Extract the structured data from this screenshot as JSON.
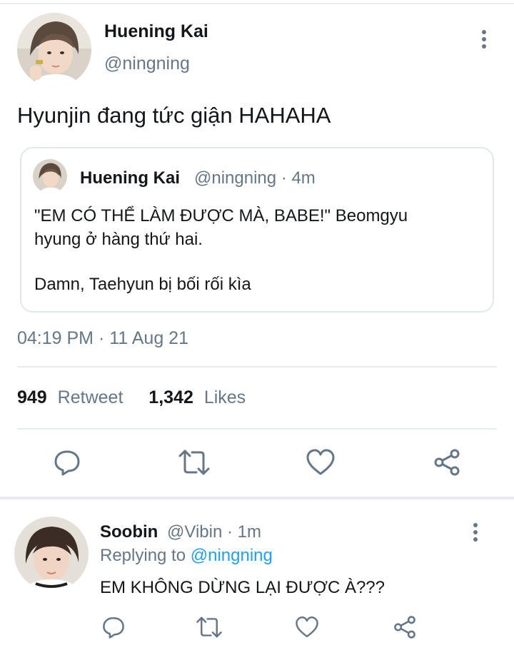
{
  "main_tweet": {
    "author_name": "Huening Kai",
    "author_handle": "@ningning",
    "text": "Hyunjin đang tức giận HAHAHA",
    "avatar_icon": "user-avatar-photo",
    "quoted": {
      "author_name": "Huening Kai",
      "meta": "@ningning · 4m",
      "line1": "\"EM CÓ THỂ LÀM ĐƯỢC MÀ, BABE!\" Beomgyu",
      "line2": "hyung ở hàng thứ hai.",
      "line3": "Damn, Taehyun bị bối rối kìa"
    },
    "timestamp": "04:19 PM · 11 Aug 21",
    "retweet_count": "949",
    "retweet_label": "Retweet",
    "like_count": "1,342",
    "like_label": "Likes"
  },
  "reply": {
    "author_name": "Soobin",
    "meta": "@Vibin · 1m",
    "replying_prefix": "Replying to",
    "replying_to": "@ningning",
    "text": "EM KHÔNG DỪNG LẠI ĐƯỢC À???"
  },
  "colors": {
    "text": "#14171a",
    "secondary": "#657786",
    "accent": "#1da1f2",
    "divider": "#e6ecf0"
  },
  "icons": [
    "more-vertical-icon",
    "reply-icon",
    "retweet-icon",
    "like-icon",
    "share-icon"
  ]
}
